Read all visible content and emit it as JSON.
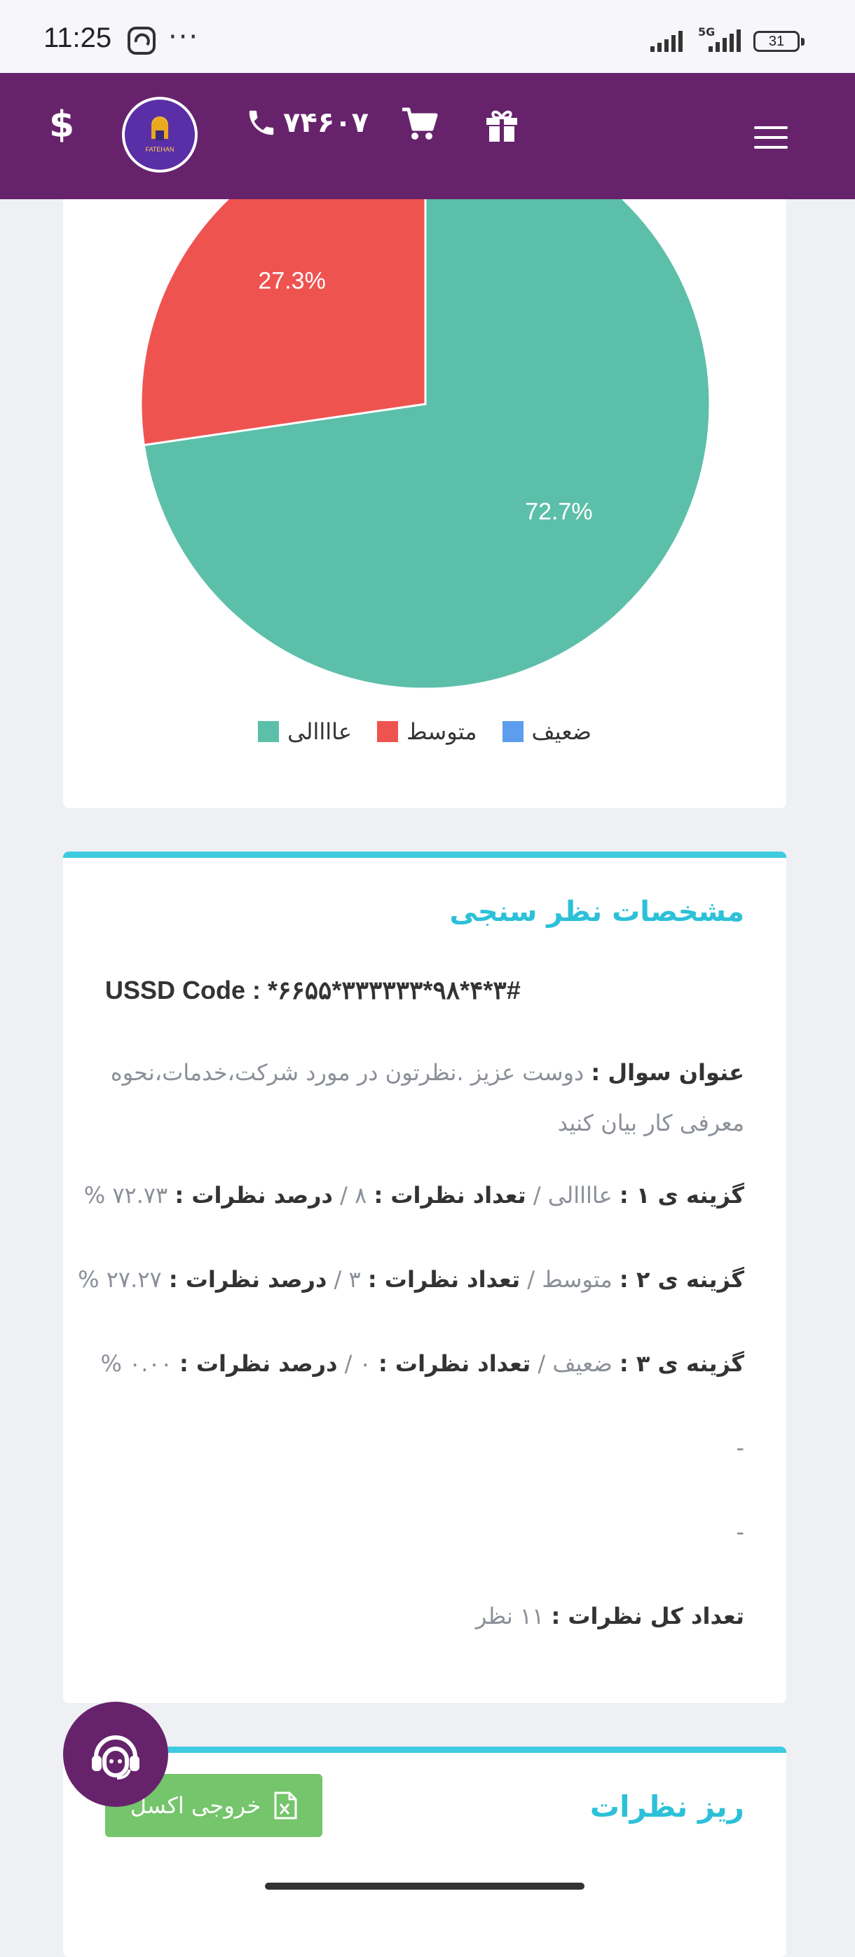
{
  "status_bar": {
    "time": "11:25",
    "dots": "···",
    "network": "5G",
    "battery": "31"
  },
  "header": {
    "currency_symbol": "$",
    "logo_text": "FATEHAN",
    "phone_number": "۷۴۶۰۷",
    "icons": [
      "currency-icon",
      "logo-icon",
      "phone-icon",
      "cart-icon",
      "gift-icon",
      "menu-icon"
    ],
    "bg_color": "#66236b"
  },
  "chart_data": {
    "type": "pie",
    "series": [
      {
        "name": "عاااالی",
        "value": 72.7,
        "label": "72.7%",
        "color": "#5cbfa9"
      },
      {
        "name": "متوسط",
        "value": 27.3,
        "label": "27.3%",
        "color": "#ef5350"
      },
      {
        "name": "ضعیف",
        "value": 0,
        "label": "",
        "color": "#5c9ded"
      }
    ],
    "legend_position": "bottom"
  },
  "legend": {
    "items": [
      {
        "label": "ضعیف",
        "color": "#5c9ded"
      },
      {
        "label": "متوسط",
        "color": "#ef5350"
      },
      {
        "label": "عاااالی",
        "color": "#5cbfa9"
      }
    ]
  },
  "info": {
    "title": "مشخصات نظر سنجی",
    "ussd": "USSD Code : *۶۶۵۵*۳۳۳۳۳۳*۹۸*۴*۳#",
    "question_label": "عنوان سوال :",
    "question_value": "دوست عزیز .نظرتون در مورد شرکت،خدمات،نحوه معرفی کار بیان کنید",
    "options": [
      {
        "label": "گزینه ی ۱ :",
        "name": "عاااالی",
        "count_label": "تعداد نظرات :",
        "count": "۸",
        "percent_label": "درصد نظرات :",
        "percent": "۷۲.۷۳ %"
      },
      {
        "label": "گزینه ی ۲ :",
        "name": "متوسط",
        "count_label": "تعداد نظرات :",
        "count": "۳",
        "percent_label": "درصد نظرات :",
        "percent": "۲۷.۲۷ %"
      },
      {
        "label": "گزینه ی ۳ :",
        "name": "ضعیف",
        "count_label": "تعداد نظرات :",
        "count": "۰",
        "percent_label": "درصد نظرات :",
        "percent": "۰.۰۰ %"
      }
    ],
    "separator": "/",
    "dash_1": "-",
    "dash_2": "-",
    "total_label": "تعداد کل نظرات :",
    "total_value": "۱۱ نظر"
  },
  "details": {
    "title": "ریز نظرات",
    "excel_button": "خروجی اکسل"
  },
  "colors": {
    "accent": "#3ecbe0",
    "brand": "#66236b",
    "excel": "#74c56b"
  }
}
